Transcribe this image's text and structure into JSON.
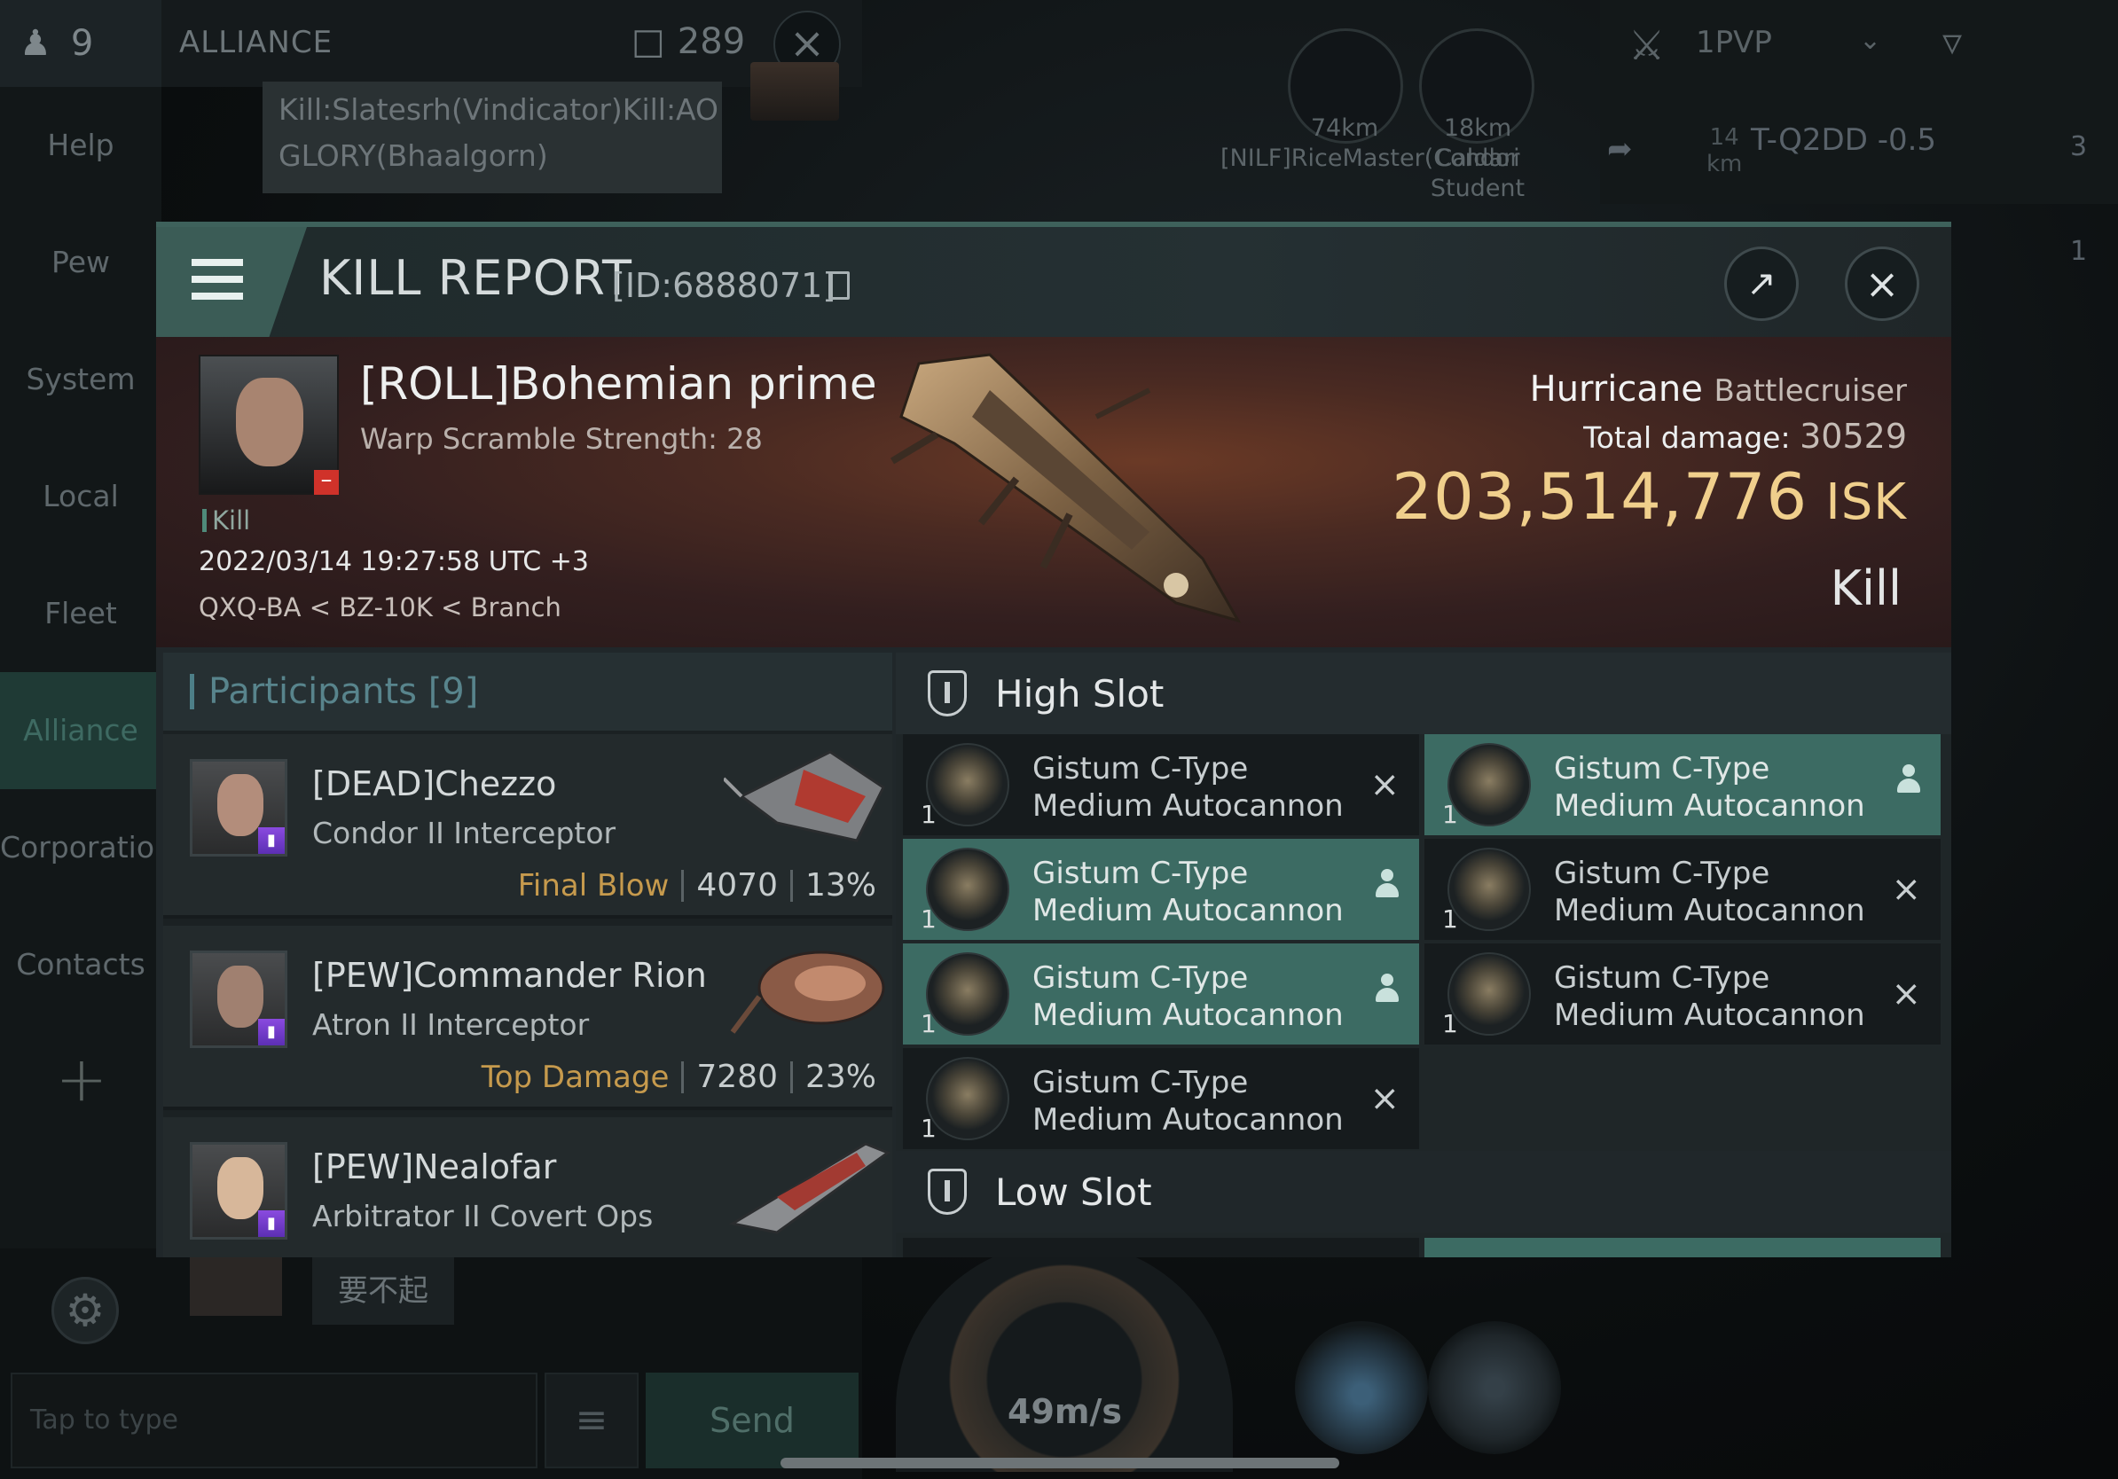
{
  "background": {
    "member_count": "9",
    "channel_tab": "ALLIANCE",
    "message_count": "289",
    "chat_message": "Kill:Slatesrh(Vindicator)Kill:AO GLORY(Bhaalgorn)",
    "nav_items": [
      "Help",
      "Pew",
      "System",
      "Local",
      "Fleet",
      "Alliance",
      "Corporation",
      "Contacts"
    ],
    "overview_filter": "1PVP",
    "targets": [
      {
        "distance": "74km",
        "name": "[NILF]RiceMaster(Condor"
      },
      {
        "distance": "18km",
        "name": "Caldari Student"
      }
    ],
    "system_distance": "14",
    "system_distance_unit": "km",
    "system_name": "T-Q2DD -0.5",
    "right_badges": [
      "3",
      "1"
    ],
    "chinese_message": "要不起",
    "chat_input_placeholder": "Tap to type",
    "send_label": "Send",
    "speed": "49m/s"
  },
  "kill_report": {
    "title": "KILL REPORT",
    "id": "[ID:6888071]",
    "victim": {
      "name": "[ROLL]Bohemian prime",
      "warp_scramble": "Warp Scramble Strength: 28",
      "tag": "Kill",
      "datetime": "2022/03/14 19:27:58 UTC +3",
      "location": "QXQ-BA < BZ-10K < Branch",
      "ship": "Hurricane",
      "ship_class": "Battlecruiser",
      "total_damage_label": "Total damage:",
      "total_damage": "30529",
      "isk_value": "203,514,776",
      "isk_unit": "ISK",
      "result": "Kill"
    },
    "participants_label": "Participants",
    "participants_count": "[9]",
    "participants": [
      {
        "name": "[DEAD]Chezzo",
        "ship": "Condor II Interceptor",
        "label": "Final Blow",
        "damage": "4070",
        "percent": "13%"
      },
      {
        "name": "[PEW]Commander Rion",
        "ship": "Atron II Interceptor",
        "label": "Top Damage",
        "damage": "7280",
        "percent": "23%"
      },
      {
        "name": "[PEW]Nealofar",
        "ship": "Arbitrator II Covert Ops",
        "label": "",
        "damage": "",
        "percent": ""
      }
    ],
    "high_slot_label": "High Slot",
    "low_slot_label": "Low Slot",
    "modules": [
      {
        "qty": "1",
        "line1": "Gistum C-Type",
        "line2": "Medium Autocannon",
        "state": "destroyed"
      },
      {
        "qty": "1",
        "line1": "Gistum C-Type",
        "line2": "Medium Autocannon",
        "state": "dropped"
      },
      {
        "qty": "1",
        "line1": "Gistum C-Type",
        "line2": "Medium Autocannon",
        "state": "dropped"
      },
      {
        "qty": "1",
        "line1": "Gistum C-Type",
        "line2": "Medium Autocannon",
        "state": "destroyed"
      },
      {
        "qty": "1",
        "line1": "Gistum C-Type",
        "line2": "Medium Autocannon",
        "state": "dropped"
      },
      {
        "qty": "1",
        "line1": "Gistum C-Type",
        "line2": "Medium Autocannon",
        "state": "destroyed"
      },
      {
        "qty": "1",
        "line1": "Gistum C-Type",
        "line2": "Medium Autocannon",
        "state": "destroyed"
      }
    ]
  }
}
